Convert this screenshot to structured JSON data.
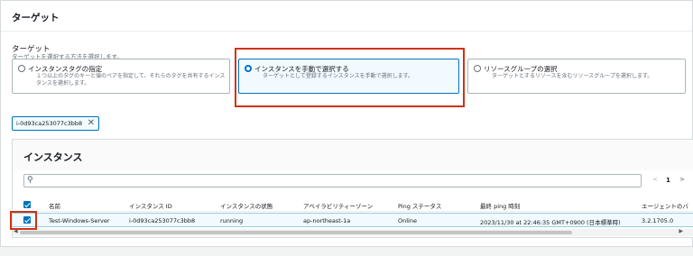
{
  "section": {
    "title": "ターゲット"
  },
  "target_field": {
    "label": "ターゲット",
    "description": "ターゲットを選択する方法を選択します。",
    "options": [
      {
        "title": "インスタンスタグの指定",
        "description": "１つ以上のタグのキーと値のペアを指定して、それらのタグを共有するインスタンスを選択します。",
        "selected": false
      },
      {
        "title": "インスタンスを手動で選択する",
        "description": "ターゲットとして登録するインスタンスを手動で選択します。",
        "selected": true
      },
      {
        "title": "リソースグループの選択",
        "description": "ターゲットとするリソースを含むリソースグループを選択します。",
        "selected": false
      }
    ]
  },
  "token": {
    "label": "i-0d93ca253077c3bb8",
    "remove_icon": "close-icon"
  },
  "instances": {
    "title": "インスタンス",
    "search_icon": "search-icon",
    "search_value": "",
    "pagination": {
      "prev": "<",
      "page": "1",
      "next": ">"
    },
    "columns": [
      "名前",
      "インスタンス ID",
      "インスタンスの状態",
      "アベイラビリティーゾーン",
      "Ping ステータス",
      "最終 ping 時刻",
      "エージェントのバ"
    ],
    "rows": [
      {
        "selected": true,
        "cells": [
          "Test-Windows-Server",
          "i-0d93ca253077c3bb8",
          "running",
          "ap-northeast-1a",
          "Online",
          "2023/11/30 at 22:46:35 GMT+0900 (日本標準時)",
          "3.2.1705.0"
        ]
      }
    ]
  },
  "colors": {
    "accent": "#0073bb",
    "highlight": "#d13212",
    "selected_bg": "#f1faff"
  }
}
